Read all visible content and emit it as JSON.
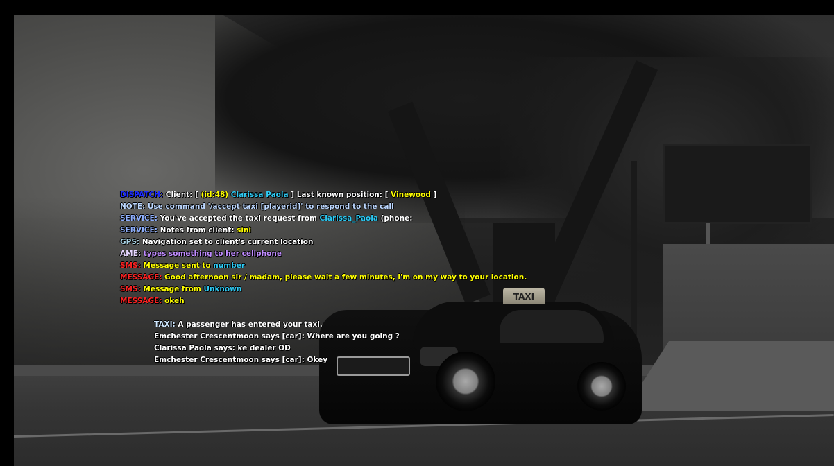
{
  "scene": {
    "taxi_sign_text": "TAXI"
  },
  "chat_log": [
    {
      "parts": [
        {
          "t": "DISPATCH:",
          "c": "dispatch"
        },
        {
          "t": " Client: [ ",
          "c": "w"
        },
        {
          "t": "(id:48)",
          "c": "yellow"
        },
        {
          "t": " Clarissa Paola",
          "c": "cyan"
        },
        {
          "t": " ] Last known position: [ ",
          "c": "w"
        },
        {
          "t": "Vinewood",
          "c": "yellow"
        },
        {
          "t": " ]",
          "c": "w"
        }
      ]
    },
    {
      "parts": [
        {
          "t": "NOTE:",
          "c": "note"
        },
        {
          "t": " Use command '/accept taxi [playerid]' to respond to the call",
          "c": "note"
        }
      ]
    },
    {
      "parts": [
        {
          "t": "SERVICE:",
          "c": "service"
        },
        {
          "t": " You've accepted the taxi request from ",
          "c": "w"
        },
        {
          "t": "Clarissa_Paola",
          "c": "cyan"
        },
        {
          "t": " (phone: ",
          "c": "w"
        }
      ]
    },
    {
      "parts": [
        {
          "t": "SERVICE:",
          "c": "service"
        },
        {
          "t": " Notes from client: ",
          "c": "w"
        },
        {
          "t": "sini",
          "c": "yellow"
        }
      ]
    },
    {
      "parts": [
        {
          "t": "GPS:",
          "c": "gps"
        },
        {
          "t": " Navigation set to client's current location",
          "c": "w"
        }
      ]
    },
    {
      "parts": [
        {
          "t": "AME:",
          "c": "ame"
        },
        {
          "t": " types something to her cellphone",
          "c": "purple"
        }
      ]
    },
    {
      "parts": [
        {
          "t": "SMS:",
          "c": "red"
        },
        {
          "t": " Message sent to ",
          "c": "yellow"
        },
        {
          "t": "number",
          "c": "cyan"
        }
      ]
    },
    {
      "parts": [
        {
          "t": "MESSAGE:",
          "c": "red"
        },
        {
          "t": " Good afternoon sir / madam, please wait a few minutes, i'm on my way to your location.",
          "c": "yellow"
        }
      ]
    },
    {
      "parts": [
        {
          "t": "SMS:",
          "c": "red"
        },
        {
          "t": " Message from ",
          "c": "yellow"
        },
        {
          "t": "Unknown",
          "c": "cyan"
        }
      ]
    },
    {
      "parts": [
        {
          "t": "MESSAGE:",
          "c": "red"
        },
        {
          "t": " okeh",
          "c": "yellow"
        }
      ]
    }
  ],
  "local_chat": [
    {
      "parts": [
        {
          "t": "TAXI:",
          "c": "taxi"
        },
        {
          "t": " A passenger has entered your taxi.",
          "c": "w"
        }
      ]
    },
    {
      "parts": [
        {
          "t": "Emchester Crescentmoon says [car]: Where are you going ?",
          "c": "w"
        }
      ]
    },
    {
      "parts": [
        {
          "t": "Clarissa Paola says: ke dealer OD",
          "c": "w"
        }
      ]
    },
    {
      "parts": [
        {
          "t": "Emchester Crescentmoon says [car]: Okey",
          "c": "w"
        }
      ]
    }
  ]
}
